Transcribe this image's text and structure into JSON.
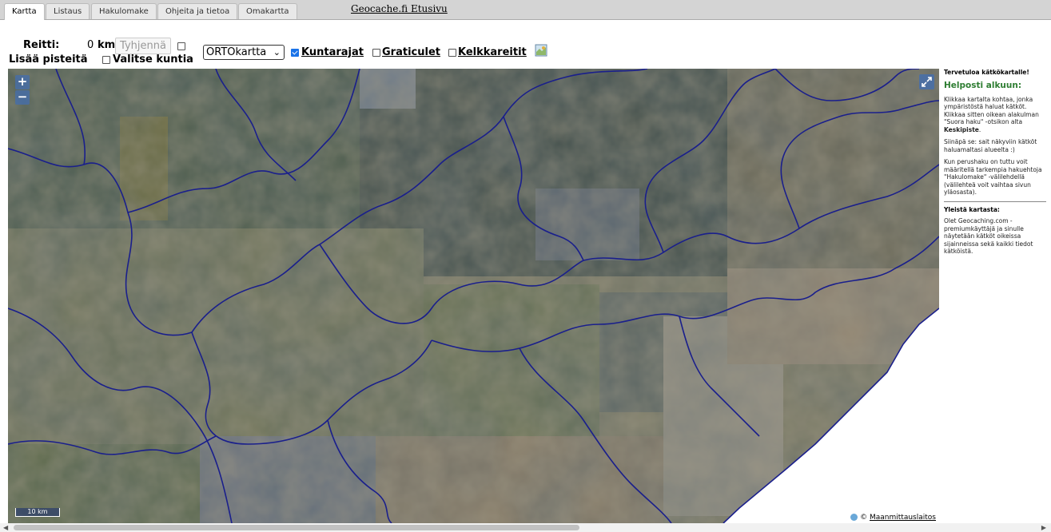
{
  "tabs": [
    "Kartta",
    "Listaus",
    "Hakulomake",
    "Ohjeita ja tietoa",
    "Omakartta"
  ],
  "home_link": "Geocache.fi Etusivu",
  "route": {
    "label": "Reitti:",
    "distance": "0",
    "unit": "km",
    "clear_button": "Tyhjennä"
  },
  "add_points_label": "Lisää pisteitä",
  "select_municipalities_label": "Valitse kuntia",
  "layer_select": {
    "selected": "ORTOkartta"
  },
  "overlays": {
    "municipal_borders": {
      "label": "Kuntarajat",
      "checked": true
    },
    "graticules": {
      "label": "Graticulet",
      "checked": false
    },
    "sled_routes": {
      "label": "Kelkkareitit",
      "checked": false
    }
  },
  "map": {
    "zoom_in": "+",
    "zoom_out": "−",
    "scale_label": "10 km",
    "attribution_symbol": "©",
    "attribution_link": "Maanmittauslaitos",
    "border_color": "#1a1f8c"
  },
  "panel": {
    "welcome": "Tervetuloa kätkökartalle!",
    "heading": "Helposti alkuun:",
    "p1_a": "Klikkaa kartalta kohtaa, jonka ympäristöstä haluat kätköt. Klikkaa sitten oikean alakulman \"Suora haku\" -otsikon alta ",
    "p1_b": "Keskipiste",
    "p1_c": ".",
    "p2": "Siinäpä se: sait näkyviin kätköt haluamaltasi alueelta :)",
    "p3": "Kun perushaku on tuttu voit määritellä tarkempia hakuehtoja \"Hakulomake\" -välilehdellä (välilehteä voit vaihtaa sivun yläosasta).",
    "general_heading": "Yleistä kartasta:",
    "p4": "Olet Geocaching.com -premiumkäyttäjä ja sinulle näytetään kätköt oikeissa sijainneissa sekä kaikki tiedot kätköistä."
  }
}
